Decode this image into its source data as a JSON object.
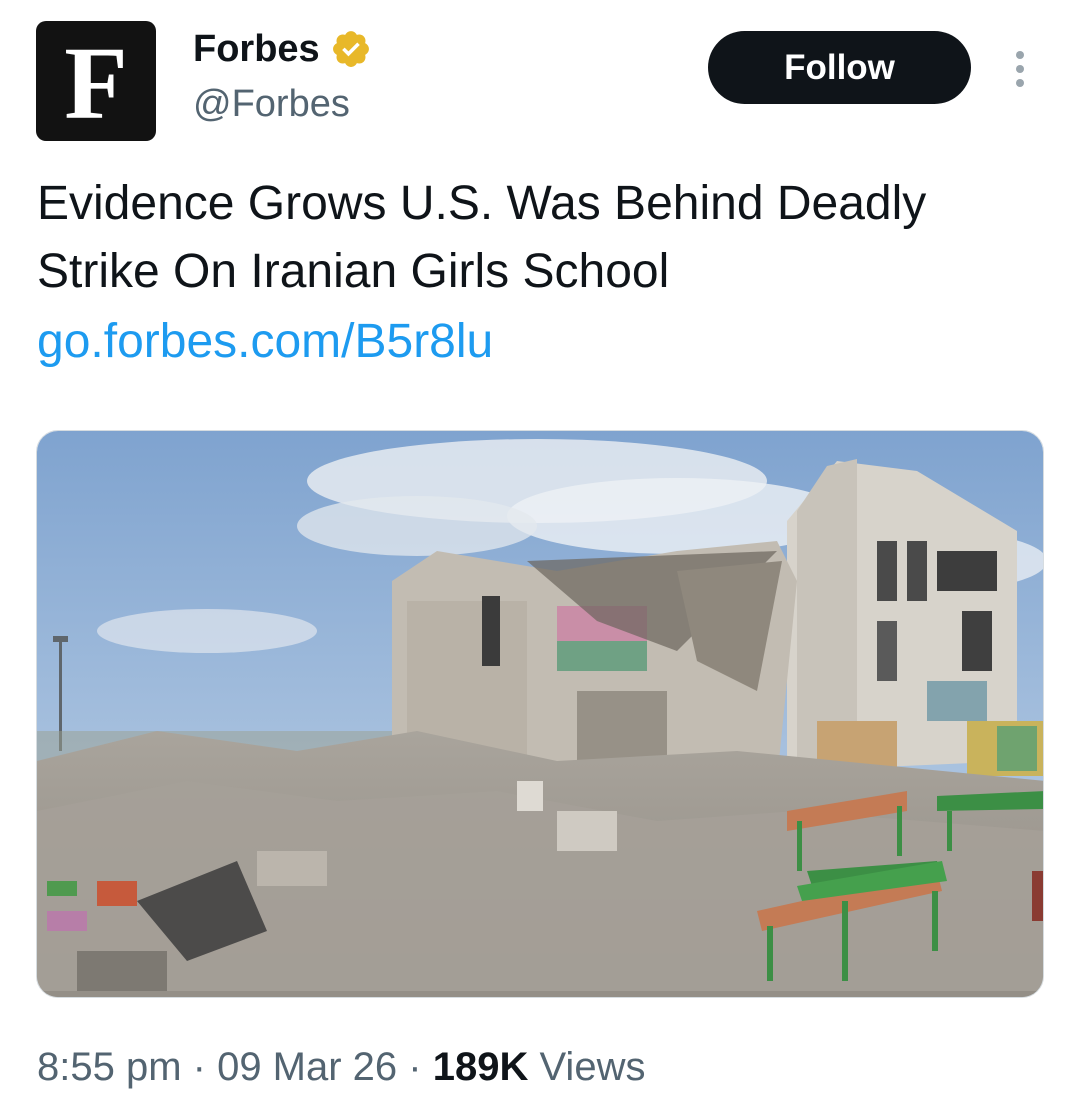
{
  "author": {
    "avatar_letter": "F",
    "display_name": "Forbes",
    "handle": "@Forbes",
    "verified_icon": "verified-badge-gold"
  },
  "follow_label": "Follow",
  "tweet": {
    "text": "Evidence Grows U.S. Was Behind Deadly Strike On Iranian Girls School",
    "link": "go.forbes.com/B5r8lu"
  },
  "media": {
    "alt": ""
  },
  "meta": {
    "time": "8:55 pm",
    "sep1": " · ",
    "date": "09 Mar 26",
    "sep2": " · ",
    "views_count": "189K",
    "views_label": " Views"
  },
  "colors": {
    "text": "#0f1419",
    "secondary": "#536471",
    "link": "#1d9bf0",
    "follow_bg": "#0f1419",
    "verified_gold": "#e8b829"
  }
}
